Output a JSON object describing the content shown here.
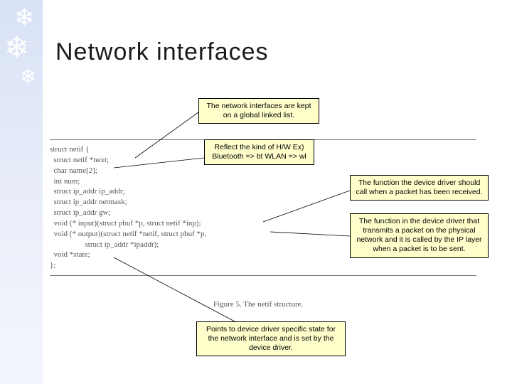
{
  "title": "Network interfaces",
  "callouts": {
    "linked_list": "The network interfaces are\nkept on a global linked list.",
    "hw_kind": "Reflect the kind of H/W\nEx) Bluetooth => bt\nWLAN => wl",
    "input_fn": "The function the device driver\nshould call when a packet has\nbeen received.",
    "output_fn": "The function in the device driver\nthat transmits a packet on the\nphysical network and it is called\nby the IP layer when a packet is\nto be sent.",
    "state_ptr": "Points to device driver specific\nstate for the network interface and\nis set by the device driver."
  },
  "code_lines": [
    "struct netif {",
    "  struct netif *next;",
    "  char name[2];",
    "  int num;",
    "  struct ip_addr ip_addr;",
    "  struct ip_addr netmask;",
    "  struct ip_addr gw;",
    "  void (* input)(struct pbuf *p, struct netif *inp);",
    "  void (* output)(struct netif *netif, struct pbuf *p,",
    "                  struct ip_addr *ipaddr);",
    "  void *state;",
    "};"
  ],
  "figure_caption": "Figure 5. The netif structure."
}
